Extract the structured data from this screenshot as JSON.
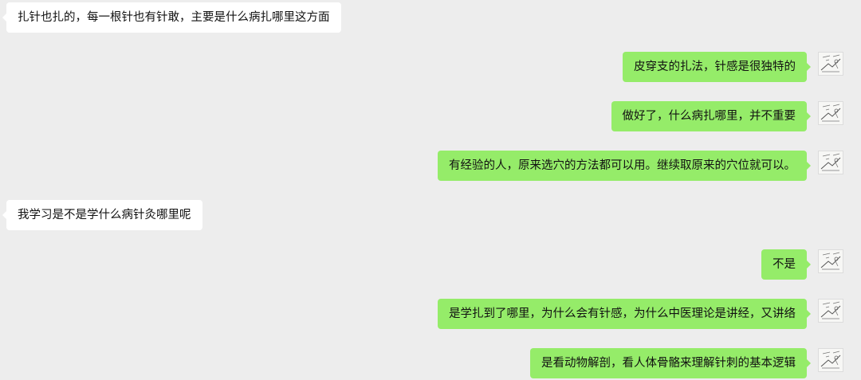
{
  "chat": {
    "messages": [
      {
        "side": "incoming",
        "text": "扎针也扎的，每一根针也有针敢，主要是什么病扎哪里这方面"
      },
      {
        "side": "outgoing",
        "text": "皮穿支的扎法，针感是很独特的",
        "avatar_icon": "sketch-avatar-icon"
      },
      {
        "side": "outgoing",
        "text": "做好了，什么病扎哪里，并不重要",
        "avatar_icon": "sketch-avatar-icon"
      },
      {
        "side": "outgoing",
        "text": "有经验的人，原来选穴的方法都可以用。继续取原来的穴位就可以。",
        "avatar_icon": "sketch-avatar-icon"
      },
      {
        "side": "incoming",
        "text": "我学习是不是学什么病针灸哪里呢"
      },
      {
        "side": "outgoing",
        "text": "不是",
        "avatar_icon": "sketch-avatar-icon"
      },
      {
        "side": "outgoing",
        "text": "是学扎到了哪里，为什么会有针感，为什么中医理论是讲经，又讲络",
        "avatar_icon": "sketch-avatar-icon"
      },
      {
        "side": "outgoing",
        "text": "是看动物解剖，看人体骨骼来理解针刺的基本逻辑",
        "avatar_icon": "sketch-avatar-icon"
      }
    ]
  },
  "colors": {
    "background": "#ededed",
    "incoming_bubble": "#ffffff",
    "outgoing_bubble": "#95ec69",
    "text": "#111111"
  }
}
